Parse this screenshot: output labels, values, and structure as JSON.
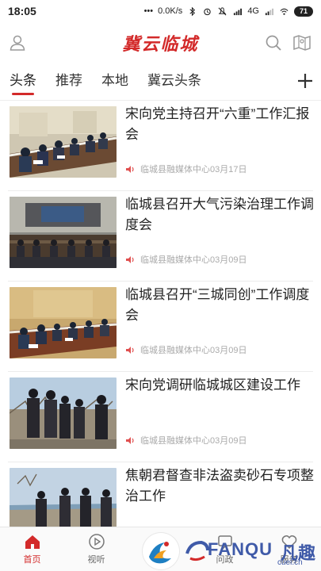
{
  "status_bar": {
    "time": "18:05",
    "network_speed": "0.0K/s",
    "network_type": "4G",
    "battery": "71"
  },
  "header": {
    "title": "冀云临城"
  },
  "tabs": [
    {
      "label": "头条",
      "active": true
    },
    {
      "label": "推荐",
      "active": false
    },
    {
      "label": "本地",
      "active": false
    },
    {
      "label": "冀云头条",
      "active": false
    }
  ],
  "news": [
    {
      "title": "宋向党主持召开“六重”工作汇报会",
      "source": "临城县融媒体中心",
      "date": "03月17日"
    },
    {
      "title": "临城县召开大气污染治理工作调度会",
      "source": "临城县融媒体中心",
      "date": "03月09日"
    },
    {
      "title": "临城县召开“三城同创”工作调度会",
      "source": "临城县融媒体中心",
      "date": "03月09日"
    },
    {
      "title": "宋向党调研临城城区建设工作",
      "source": "临城县融媒体中心",
      "date": "03月09日"
    },
    {
      "title": "焦朝君督查非法盗卖砂石专项整治工作",
      "source": "",
      "date": ""
    }
  ],
  "bottom_nav": [
    {
      "label": "首页",
      "icon": "home-icon",
      "active": true
    },
    {
      "label": "视听",
      "icon": "play-icon",
      "active": false
    },
    {
      "label": "",
      "icon": "app-logo-icon",
      "active": false
    },
    {
      "label": "问政",
      "icon": "ask-icon",
      "active": false
    },
    {
      "label": "服务",
      "icon": "service-icon",
      "active": false
    }
  ],
  "watermark": {
    "text": "FANQU",
    "cn": "凡趣",
    "sub": "cuel.cn"
  },
  "colors": {
    "accent": "#d32a2a",
    "meta_text": "#aaaaaa",
    "watermark": "#3f5aa8"
  }
}
